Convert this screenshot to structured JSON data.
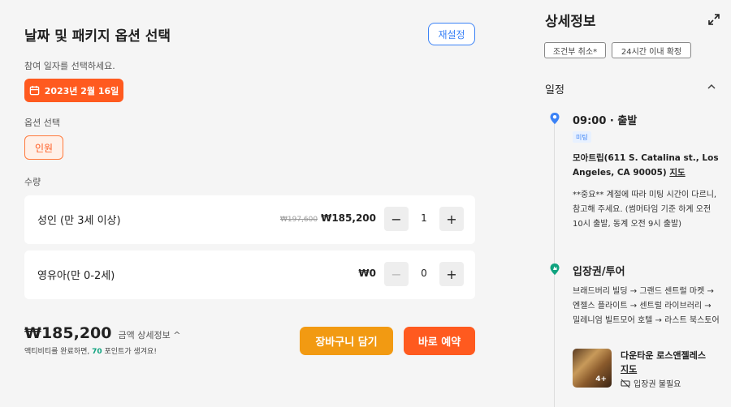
{
  "booking": {
    "title": "날짜 및 패키지 옵션 선택",
    "reset_label": "재설정",
    "date_prompt": "참여 일자를 선택하세요.",
    "selected_date": "2023년 2월 16일",
    "option_label": "옵션 선택",
    "option_chip": "인원",
    "quantity_label": "수량",
    "rows": [
      {
        "name": "성인 (만 3세 이상)",
        "old_price": "₩197,600",
        "price": "₩185,200",
        "qty": "1"
      },
      {
        "name": "영유아(만 0-2세)",
        "old_price": "",
        "price": "₩0",
        "qty": "0"
      }
    ],
    "total_price": "₩185,200",
    "total_detail": "금액 상세정보 ^",
    "points_pre": "액티비티를 완료하면, ",
    "points_value": "70",
    "points_post": " 포인트가 생겨요!",
    "cart_label": "장바구니 담기",
    "book_label": "바로 예약"
  },
  "details": {
    "title": "상세정보",
    "tags": [
      "조건부 취소*",
      "24시간 이내 확정"
    ],
    "section": "일정",
    "stop1": {
      "time": "09:00 · 출발",
      "badge": "미팅",
      "address": "모아트립(611 S. Catalina st., Los Angeles, CA 90005)",
      "map_link": "지도",
      "note": "**중요** 계절에 따라 미팅 시간이 다르니, 참고해 주세요. (썸머타임 기준 하계 오전 10시 출발, 동계 오전 9시 출발)"
    },
    "stop2": {
      "title": "입장권/투어",
      "route": "브래드버리 빌딩 → 그랜드 센트럴 마켓 → 엔젤스 플라이트 → 센트럴 라이브러리 → 밀레니엄 빌트모어 호텔 → 라스트 북스토어",
      "poi_name": "다운타운 로스앤젤레스",
      "poi_map": "지도",
      "photo_count": "4+",
      "ticket_note": "입장권 불필요"
    }
  },
  "colors": {
    "accent": "#ff5a1f",
    "cart": "#f29a12",
    "link_blue": "#3b82f6",
    "points_green": "#10a37f"
  }
}
